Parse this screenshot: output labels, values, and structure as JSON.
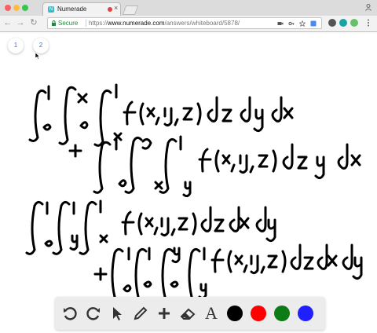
{
  "browser": {
    "tab_title": "Numerade",
    "tab_favicon": "N",
    "secure_label": "Secure",
    "url_scheme": "https://",
    "url_host": "www.numerade.com",
    "url_path": "/answers/whiteboard/5878/"
  },
  "whiteboard": {
    "pages": [
      "1",
      "2"
    ]
  },
  "toolbar": {
    "tools": [
      "undo-icon",
      "redo-icon",
      "pointer-icon",
      "pencil-icon",
      "plus-icon",
      "eraser-icon",
      "text-icon"
    ],
    "text_tool_label": "A",
    "colors": [
      "#000000",
      "#ff0000",
      "#0e7c16",
      "#1f1fff"
    ]
  }
}
